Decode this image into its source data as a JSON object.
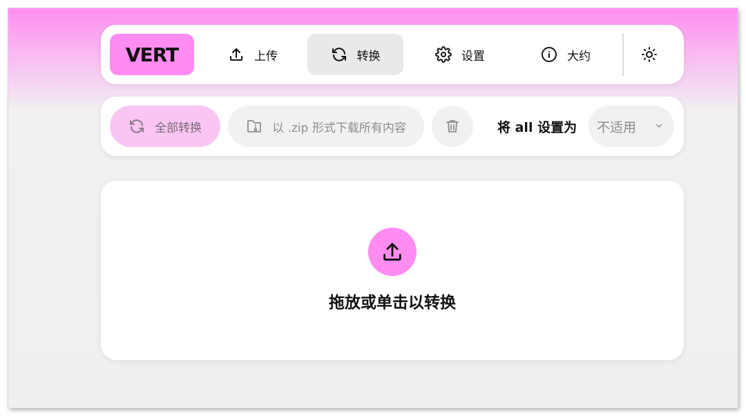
{
  "app": {
    "logo": "VERT"
  },
  "nav": {
    "items": [
      {
        "label": "上传",
        "icon": "upload-icon"
      },
      {
        "label": "转换",
        "icon": "refresh-icon",
        "active": true
      },
      {
        "label": "设置",
        "icon": "gear-icon"
      },
      {
        "label": "大约",
        "icon": "info-icon"
      }
    ],
    "theme_toggle_icon": "sun-icon"
  },
  "toolbar": {
    "convert_all_label": "全部转换",
    "zip_label": "以 .zip 形式下载所有内容",
    "delete_icon": "trash-icon",
    "set_all_label": "将 all 设置为",
    "format_select_value": "不适用"
  },
  "dropzone": {
    "label": "拖放或单击以转换",
    "icon": "upload-icon"
  },
  "colors": {
    "accent": "#ff8cf0",
    "accent_light": "#f9c6f3",
    "active_bg": "#e9e9e9"
  }
}
